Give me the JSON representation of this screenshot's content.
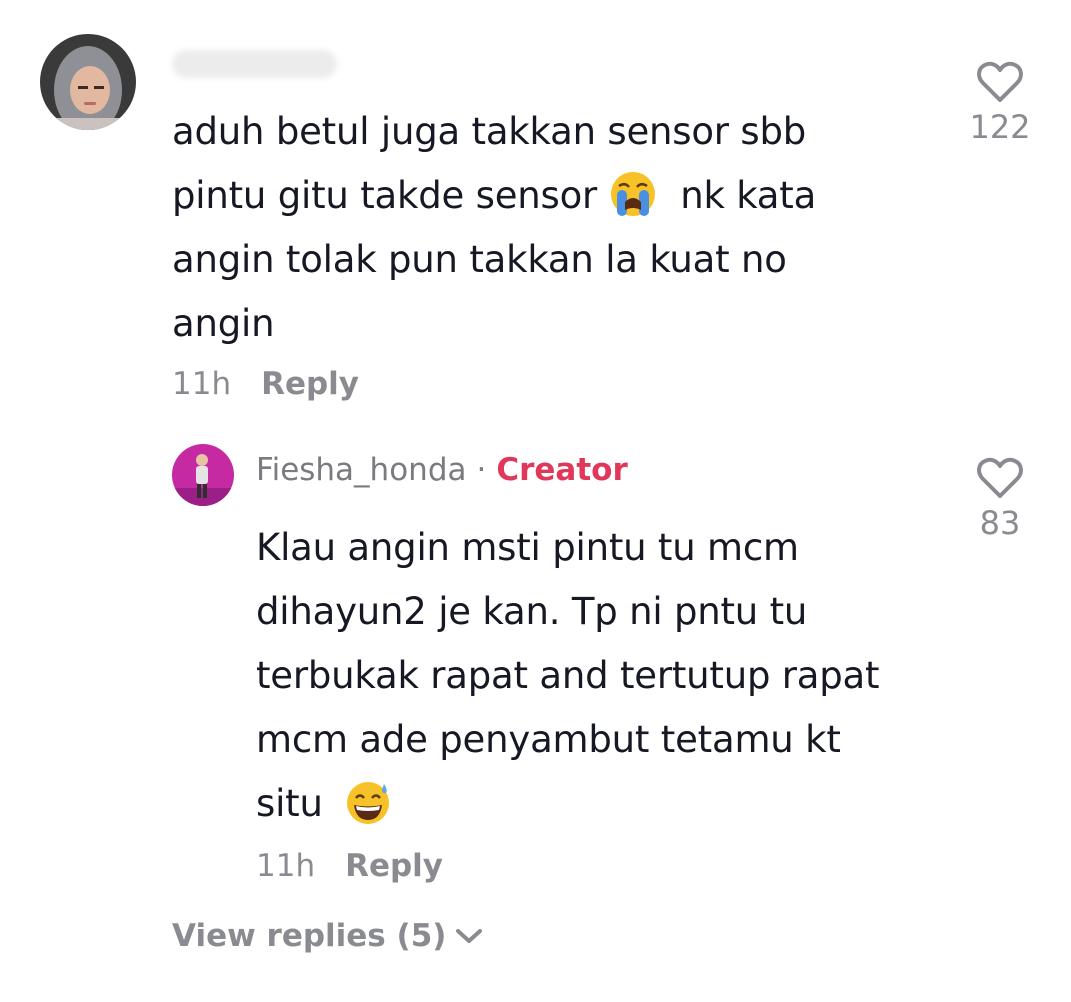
{
  "comment": {
    "text_lines": [
      "aduh betul juga takkan sensor sbb",
      "pintu gitu takde sensor",
      "nk kata",
      "angin tolak pun takkan la kuat no",
      "angin"
    ],
    "emoji": "loudly-crying-face",
    "time": "11h",
    "reply_label": "Reply",
    "likes": "122"
  },
  "reply": {
    "username": "Fiesha_honda",
    "separator": "·",
    "badge": "Creator",
    "text_lines": [
      "Klau angin msti pintu tu mcm",
      "dihayun2 je kan. Tp ni pntu tu",
      "terbukak rapat and tertutup rapat",
      "mcm ade penyambut tetamu kt",
      "situ"
    ],
    "emoji": "grinning-face-with-sweat",
    "time": "11h",
    "reply_label": "Reply",
    "likes": "83"
  },
  "view_replies": {
    "label": "View replies (5)"
  },
  "colors": {
    "text": "#161823",
    "muted": "#8a8b91",
    "creator": "#e0385b"
  }
}
